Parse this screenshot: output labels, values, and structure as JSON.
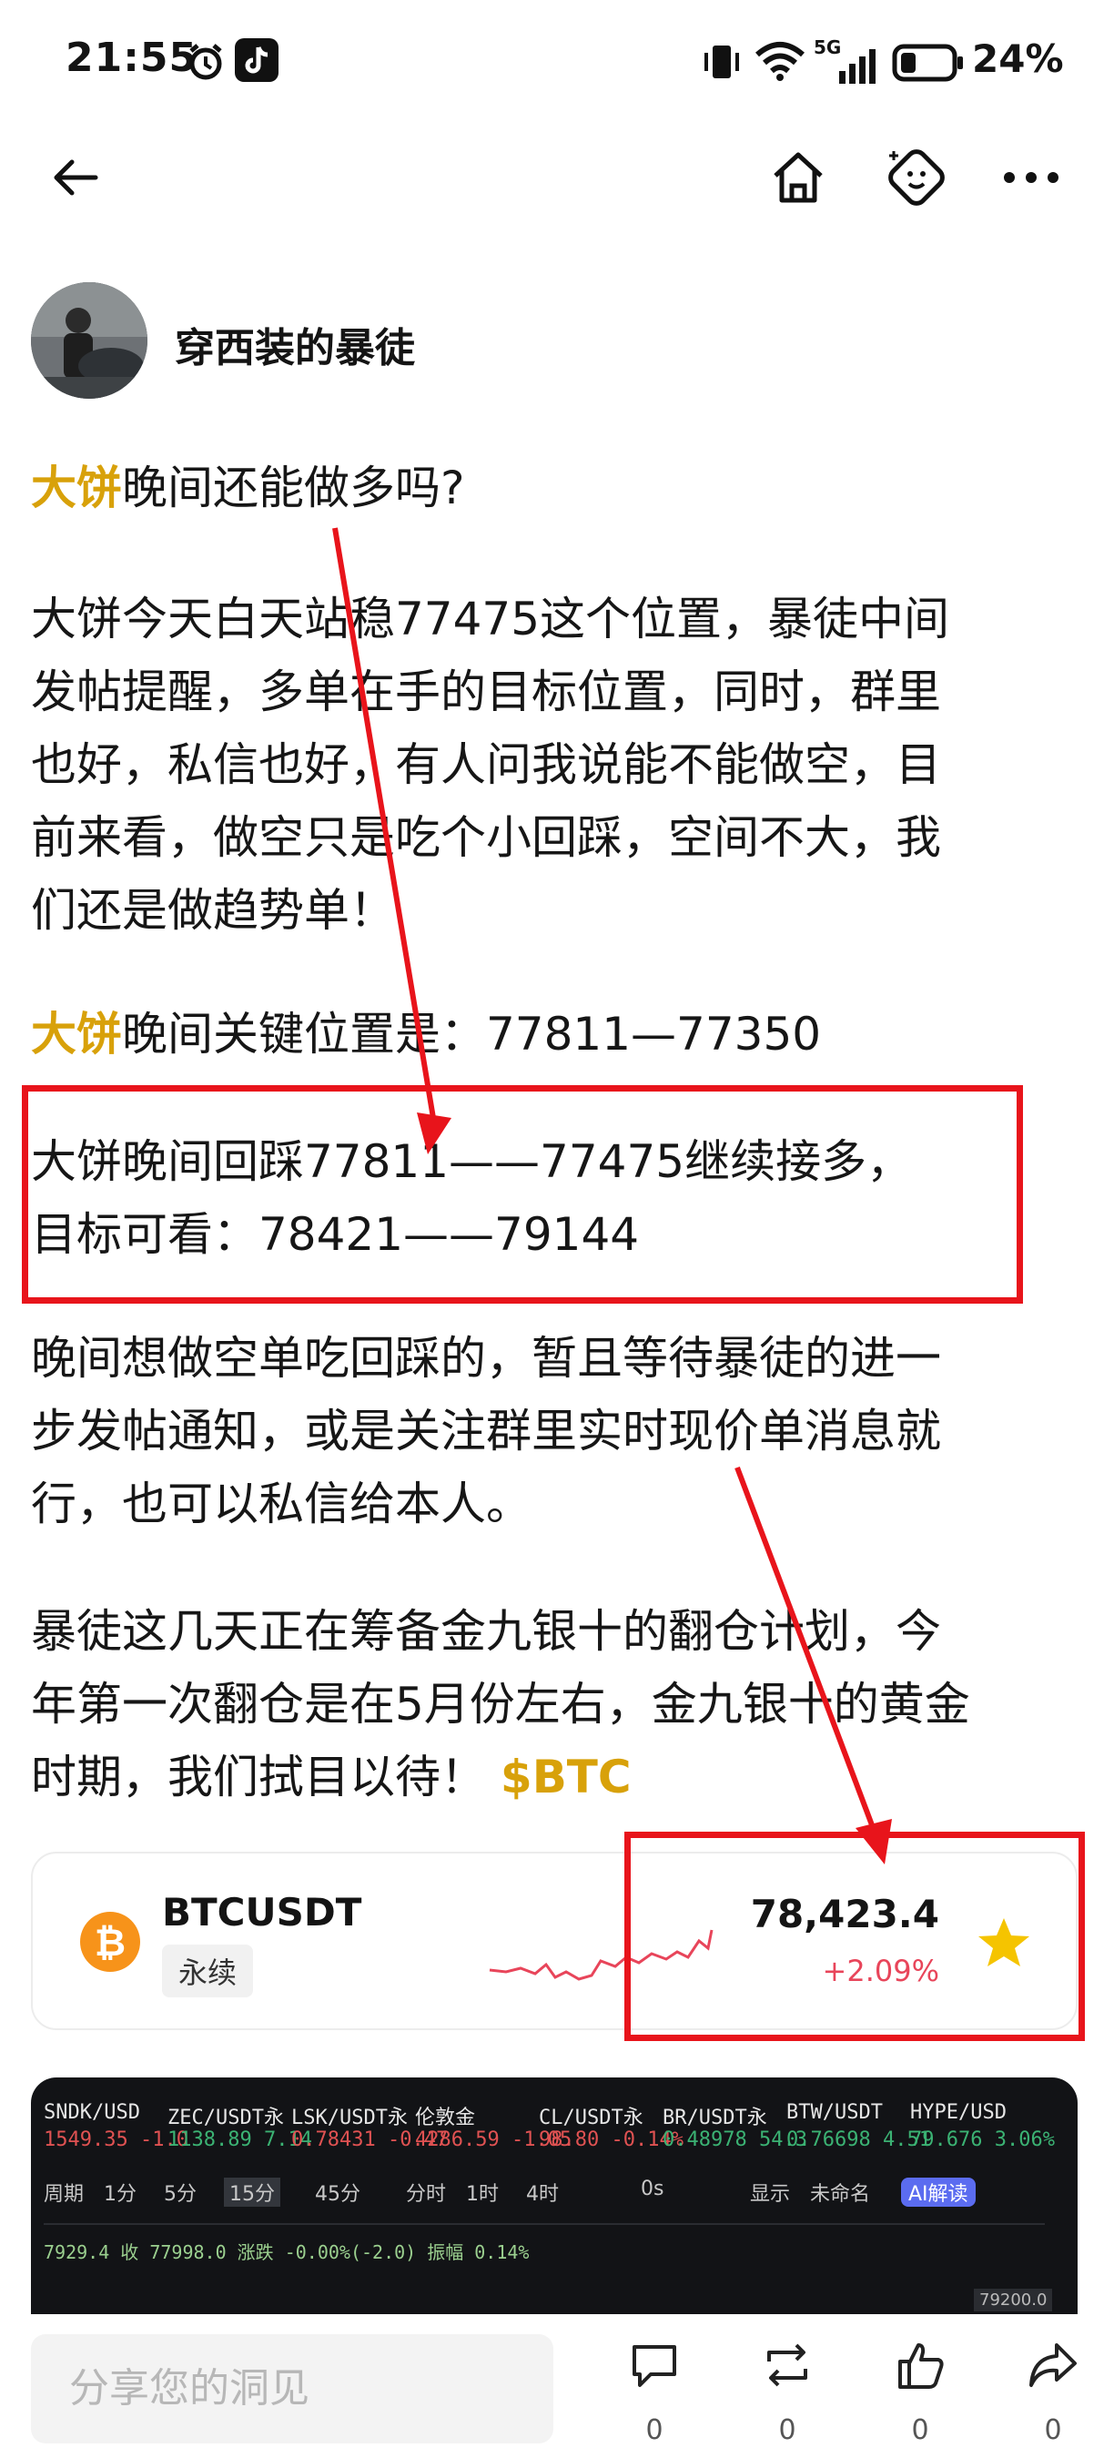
{
  "status_bar": {
    "time": "21:55",
    "battery": "24%",
    "network": "5G"
  },
  "nav": {
    "back": "back-icon",
    "home": "home-icon",
    "emoji": "emoji-icon",
    "more": "more-icon"
  },
  "post": {
    "author": "穿西装的暴徒",
    "tag_dabing": "大饼",
    "p1_rest": "晚间还能做多吗?",
    "p2_lines": [
      "大饼今天白天站稳77475这个位置，暴徒中间",
      "发帖提醒，多单在手的目标位置，同时，群里",
      "也好，私信也好，有人问我说能不能做空，目",
      "前来看，做空只是吃个小回踩，空间不大，我",
      "们还是做趋势单！"
    ],
    "p3_rest": "晚间关键位置是：77811—77350",
    "p4_lines": [
      "大饼晚间回踩77811——77475继续接多，",
      "目标可看：78421——79144"
    ],
    "p5_lines": [
      "晚间想做空单吃回踩的，暂且等待暴徒的进一",
      "步发帖通知，或是关注群里实时现价单消息就",
      "行，也可以私信给本人。"
    ],
    "p6_lines": [
      "暴徒这几天正在筹备金九银十的翻仓计划，今",
      "年第一次翻仓是在5月份左右，金九银十的黄金"
    ],
    "p6_last": "时期，我们拭目以待！",
    "cashtag": "$BTC"
  },
  "ticker_card": {
    "symbol": "BTCUSDT",
    "type": "永续",
    "price": "78,423.4",
    "change": "+2.09%",
    "change_color": "#e8455a",
    "coin_icon": "bitcoin-icon",
    "favorite_icon": "star-icon"
  },
  "chart_preview": {
    "quotes": [
      {
        "symbol": "SNDK/USD",
        "price": "1549.35",
        "change": "-1.0"
      },
      {
        "symbol": "ZEC/USDT永",
        "price": "1138.89",
        "change": "7.14"
      },
      {
        "symbol": "LSK/USDT永",
        "price": "0.78431",
        "change": "-0.47"
      },
      {
        "symbol": "伦敦金",
        "price": "4286.59",
        "change": "-1.05"
      },
      {
        "symbol": "CL/USDT永",
        "price": "98.80",
        "change": "-0.14%"
      },
      {
        "symbol": "BR/USDT永",
        "price": "0.48978",
        "change": "54.3"
      },
      {
        "symbol": "BTW/USDT",
        "price": "0.76698",
        "change": "4.51"
      },
      {
        "symbol": "HYPE/USD",
        "price": "79.676",
        "change": "3.06%"
      }
    ],
    "toolbar": [
      "周期",
      "1分",
      "5分",
      "15分",
      "45分",
      "分时",
      "1时",
      "4时",
      "0s",
      "显示",
      "未命名",
      "AI解读"
    ],
    "info_line": "7929.4 收 77998.0 涨跌 -0.00%(-2.0) 振幅 0.14%",
    "price_label": "79200.0"
  },
  "bottom_bar": {
    "placeholder": "分享您的洞见",
    "comments": "0",
    "reposts": "0",
    "likes": "0",
    "shares": "0"
  }
}
